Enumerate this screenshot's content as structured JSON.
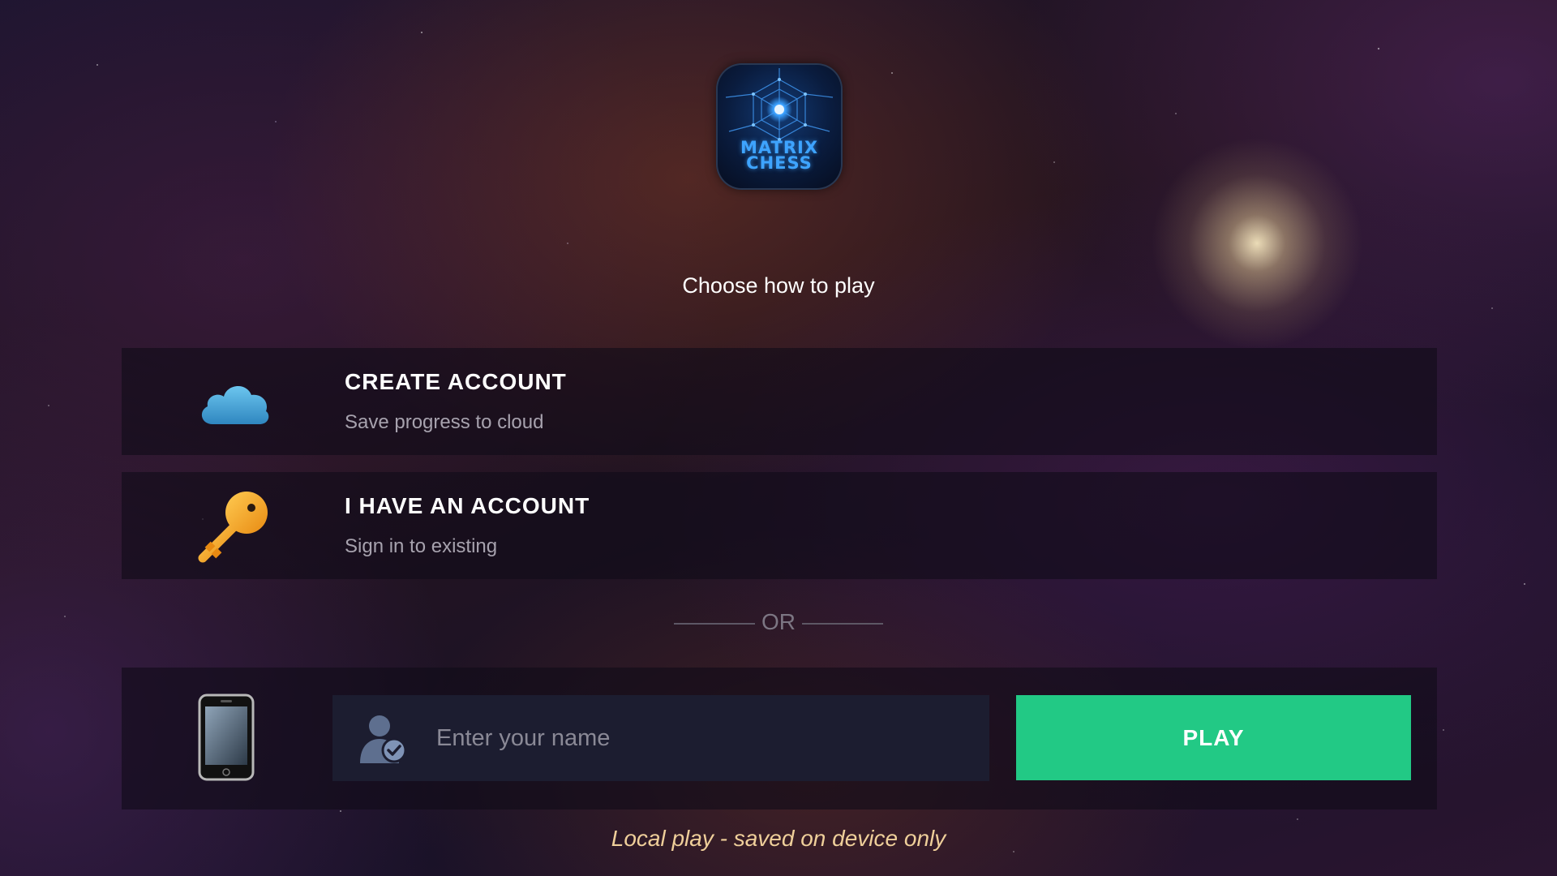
{
  "logo": {
    "line1": "MATRIX",
    "line2": "CHESS",
    "icon": "matrix-chess-logo"
  },
  "subtitle": "Choose how to play",
  "options": [
    {
      "title": "CREATE ACCOUNT",
      "subtitle": "Save progress to cloud",
      "icon": "cloud-icon"
    },
    {
      "title": "I HAVE AN ACCOUNT",
      "subtitle": "Sign in to existing",
      "icon": "key-icon"
    }
  ],
  "divider": "OR",
  "local": {
    "device_icon": "phone-icon",
    "user_icon": "user-check-icon",
    "name_value": "",
    "name_placeholder": "Enter your name",
    "play_label": "PLAY",
    "note": "Local play - saved on device only"
  },
  "colors": {
    "play_button": "#22c985",
    "panel_background": "#100c18",
    "input_background": "#1c1d30",
    "logo_text": "#3ea4ff",
    "note_text": "#efcf9a",
    "key_gold": "#f5a623",
    "cloud_blue": "#4aa8d8"
  }
}
